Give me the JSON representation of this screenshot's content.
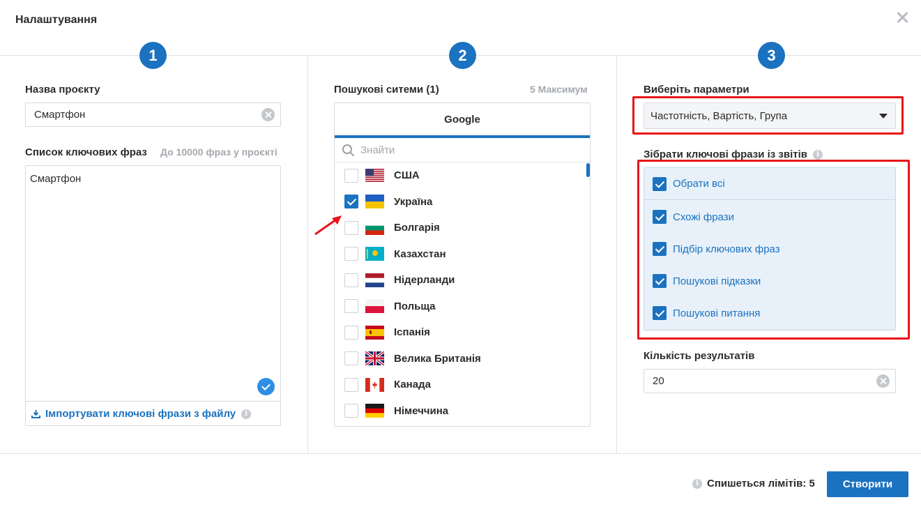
{
  "header": {
    "title": "Налаштування"
  },
  "steps": [
    "1",
    "2",
    "3"
  ],
  "column1": {
    "project_name_label": "Назва проєкту",
    "project_name_value": "Смартфон",
    "keywords_label": "Список ключових фраз",
    "keywords_hint": "До 10000 фраз у проєкті",
    "keywords_text": "Смартфон",
    "import_label": "Імпортувати ключові фрази з файлу"
  },
  "column2": {
    "engines_label": "Пошукові ситеми (1)",
    "engines_hint": "5 Максимум",
    "engine_tab": "Google",
    "search_placeholder": "Знайти",
    "countries": [
      {
        "name": "США",
        "checked": false,
        "flag": "us"
      },
      {
        "name": "Україна",
        "checked": true,
        "flag": "ua"
      },
      {
        "name": "Болгарія",
        "checked": false,
        "flag": "bg"
      },
      {
        "name": "Казахстан",
        "checked": false,
        "flag": "kz"
      },
      {
        "name": "Нідерланди",
        "checked": false,
        "flag": "nl"
      },
      {
        "name": "Польща",
        "checked": false,
        "flag": "pl"
      },
      {
        "name": "Іспанія",
        "checked": false,
        "flag": "es"
      },
      {
        "name": "Велика Британія",
        "checked": false,
        "flag": "gb"
      },
      {
        "name": "Канада",
        "checked": false,
        "flag": "ca"
      },
      {
        "name": "Німеччина",
        "checked": false,
        "flag": "de"
      }
    ]
  },
  "column3": {
    "params_label": "Виберіть параметри",
    "params_value": "Частотність, Вартість, Група",
    "reports_label": "Зібрати ключові фрази із звітів",
    "reports": [
      {
        "label": "Обрати всі",
        "checked": true
      },
      {
        "label": "Схожі фрази",
        "checked": true
      },
      {
        "label": "Підбір ключових фраз",
        "checked": true
      },
      {
        "label": "Пошукові підказки",
        "checked": true
      },
      {
        "label": "Пошукові питання",
        "checked": true
      }
    ],
    "results_label": "Кількість результатів",
    "results_value": "20"
  },
  "footer": {
    "limits_text": "Спишеться лімітів: 5",
    "create_label": "Створити"
  },
  "colors": {
    "accent": "#1b72c0",
    "highlight": "#e8141b"
  }
}
